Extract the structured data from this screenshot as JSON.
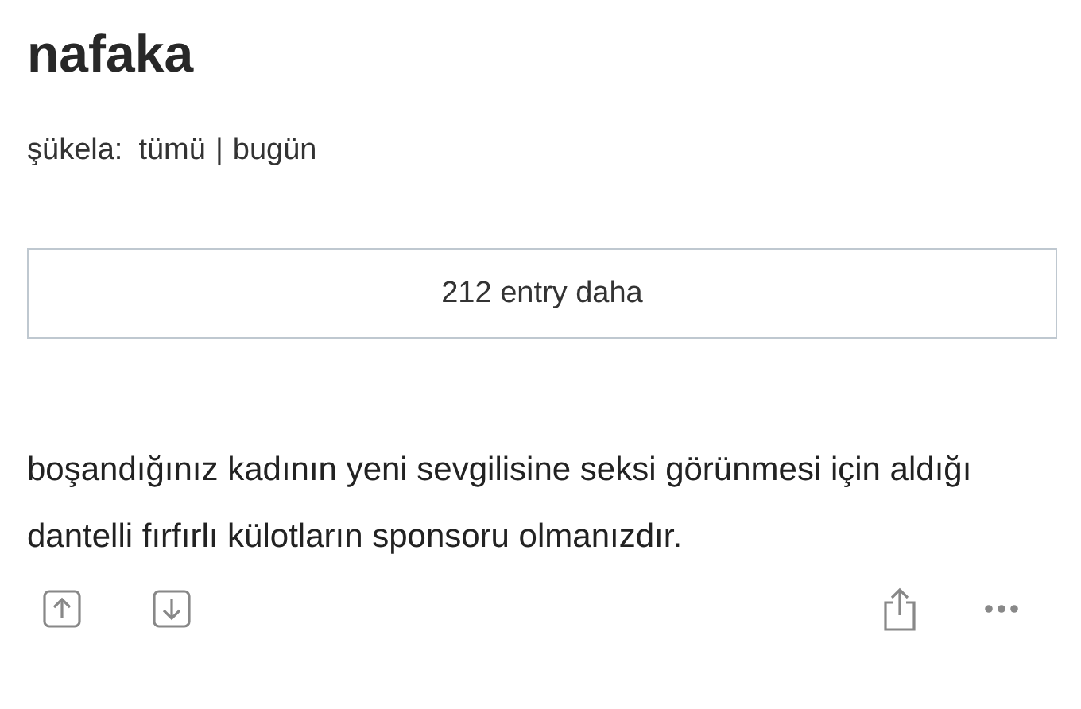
{
  "title": "nafaka",
  "filter": {
    "label": "şükela:",
    "options": [
      {
        "label": "tümü"
      },
      {
        "label": "bugün"
      }
    ],
    "separator": "|"
  },
  "more_button": {
    "label": "212 entry daha"
  },
  "entry": {
    "text": "boşandığınız kadının yeni sevgilisine seksi görünmesi için aldığı dantelli fırfırlı külotların sponsoru olmanızdır."
  }
}
